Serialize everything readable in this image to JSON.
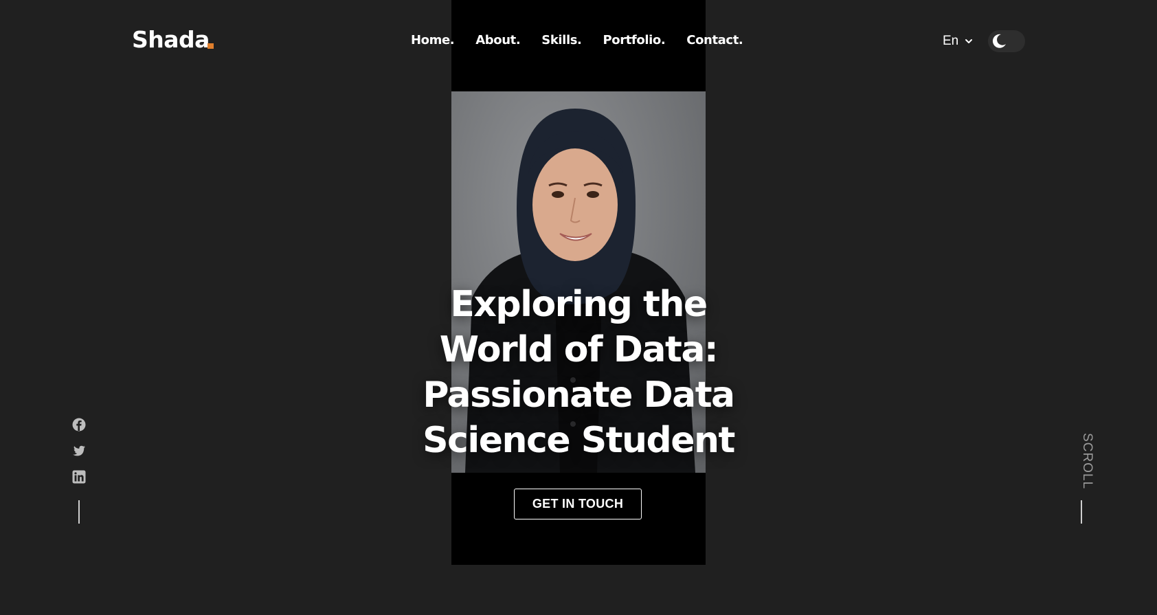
{
  "header": {
    "logo_text": "Shada",
    "logo_dot_color": "#e07f2d",
    "nav": [
      "Home.",
      "About.",
      "Skills.",
      "Portfolio.",
      "Contact."
    ],
    "language": "En",
    "theme_icon": "moon-icon"
  },
  "hero": {
    "title_lines": [
      "Exploring the",
      "World of Data:",
      "Passionate Data",
      "Science Student"
    ],
    "cta_label": "GET IN TOUCH",
    "photo_alt": "portrait-photo"
  },
  "social": {
    "icons": [
      "facebook-icon",
      "twitter-icon",
      "linkedin-icon"
    ]
  },
  "scroll": {
    "label": "SCROLL"
  },
  "colors": {
    "background": "#202020",
    "photo_column": "#000000",
    "accent": "#e07f2d",
    "text": "#ffffff"
  }
}
